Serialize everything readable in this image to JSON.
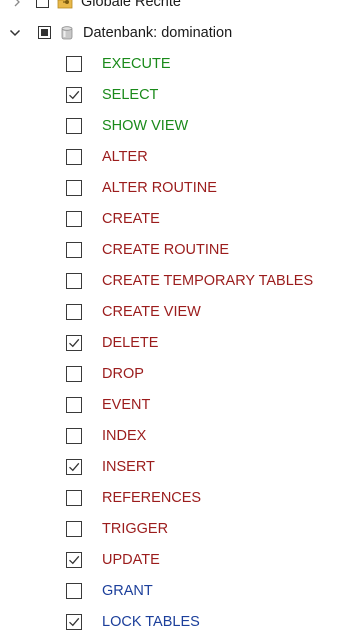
{
  "tree": {
    "top_node": {
      "label": "Globale Rechte",
      "state": "unchecked",
      "icon": "folder-key-icon"
    },
    "db_node": {
      "label": "Datenbank: domination",
      "state": "partial",
      "icon": "database-icon",
      "expanded": true
    },
    "privileges": [
      {
        "label": "EXECUTE",
        "checked": false,
        "color": "green"
      },
      {
        "label": "SELECT",
        "checked": true,
        "color": "green"
      },
      {
        "label": "SHOW VIEW",
        "checked": false,
        "color": "green"
      },
      {
        "label": "ALTER",
        "checked": false,
        "color": "red"
      },
      {
        "label": "ALTER ROUTINE",
        "checked": false,
        "color": "red"
      },
      {
        "label": "CREATE",
        "checked": false,
        "color": "red"
      },
      {
        "label": "CREATE ROUTINE",
        "checked": false,
        "color": "red"
      },
      {
        "label": "CREATE TEMPORARY TABLES",
        "checked": false,
        "color": "red"
      },
      {
        "label": "CREATE VIEW",
        "checked": false,
        "color": "red"
      },
      {
        "label": "DELETE",
        "checked": true,
        "color": "red"
      },
      {
        "label": "DROP",
        "checked": false,
        "color": "red"
      },
      {
        "label": "EVENT",
        "checked": false,
        "color": "red"
      },
      {
        "label": "INDEX",
        "checked": false,
        "color": "red"
      },
      {
        "label": "INSERT",
        "checked": true,
        "color": "red"
      },
      {
        "label": "REFERENCES",
        "checked": false,
        "color": "red"
      },
      {
        "label": "TRIGGER",
        "checked": false,
        "color": "red"
      },
      {
        "label": "UPDATE",
        "checked": true,
        "color": "red"
      },
      {
        "label": "GRANT",
        "checked": false,
        "color": "blue"
      },
      {
        "label": "LOCK TABLES",
        "checked": true,
        "color": "blue"
      }
    ]
  }
}
